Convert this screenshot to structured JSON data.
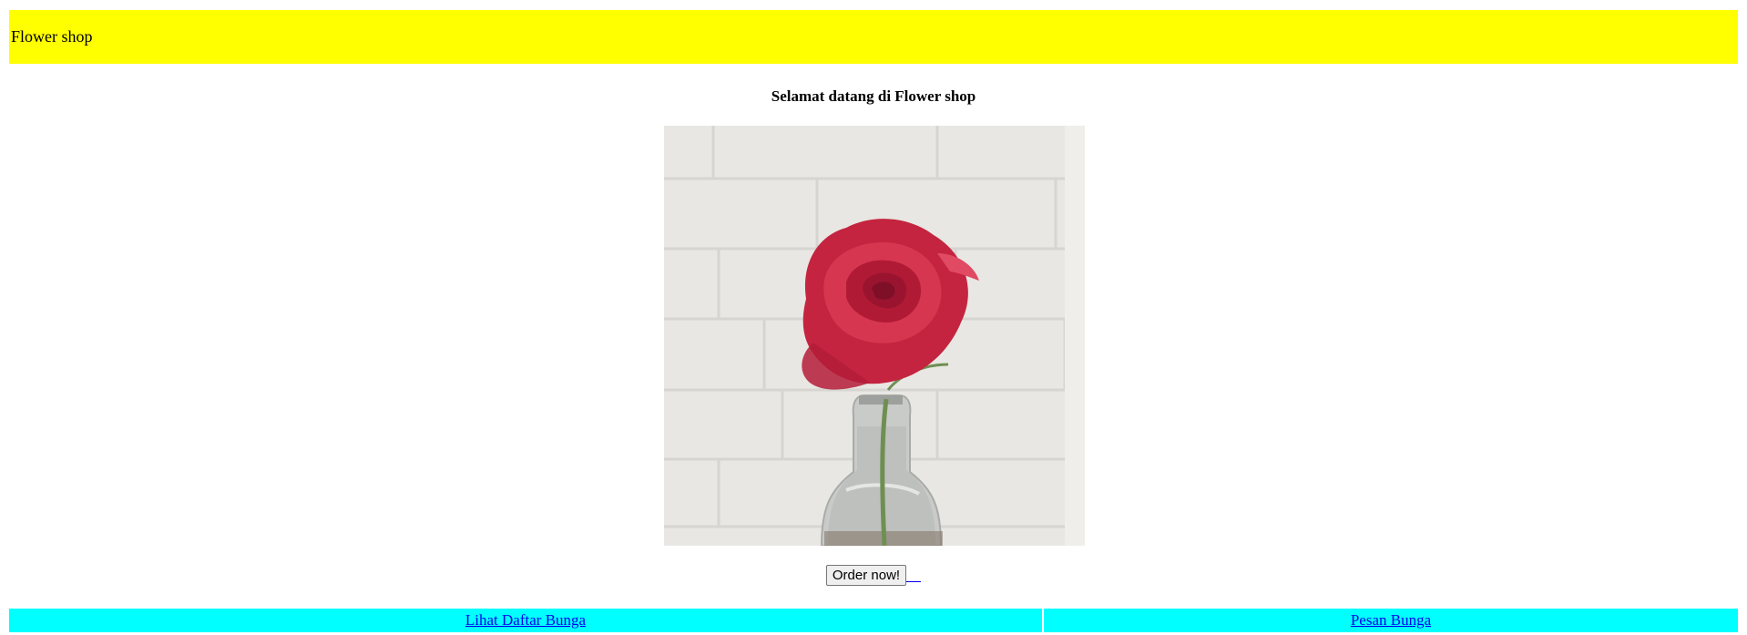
{
  "header": {
    "title": "Flower shop",
    "background_color": "#ffff00"
  },
  "main": {
    "welcome_text": "Selamat datang di Flower shop",
    "image_alt": "red-rose-in-glass-vase",
    "order_button_label": "Order now!"
  },
  "nav": {
    "background_color": "#00ffff",
    "links": [
      {
        "label": "Lihat Daftar Bunga"
      },
      {
        "label": "Pesan Bunga"
      }
    ]
  }
}
